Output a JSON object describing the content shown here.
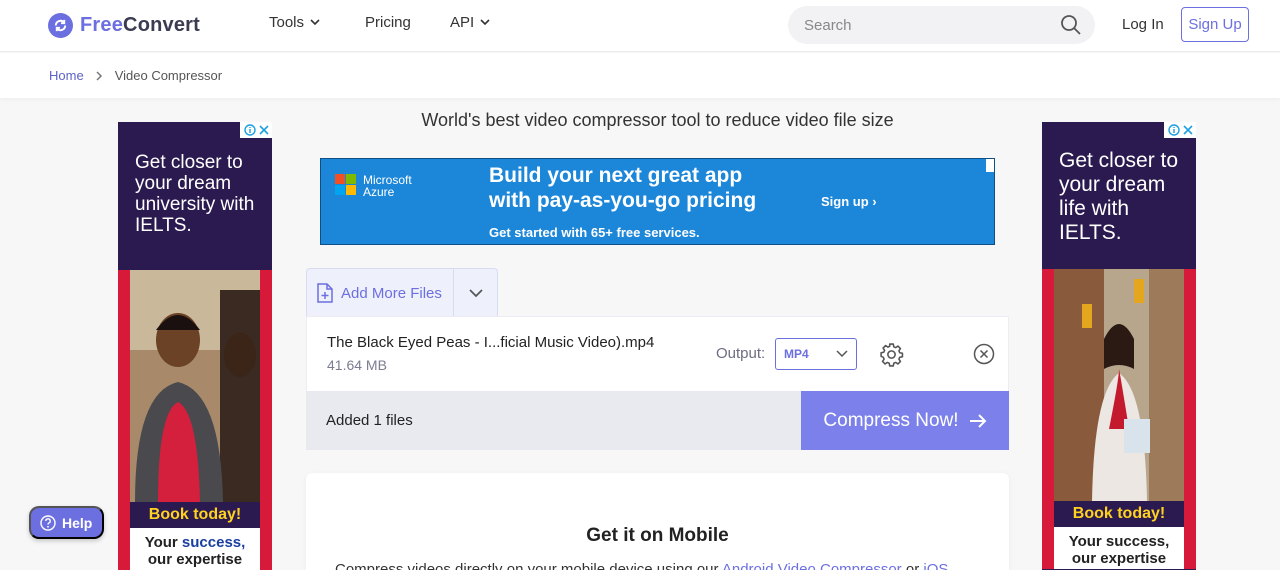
{
  "header": {
    "brand_free": "Free",
    "brand_convert": "Convert",
    "nav": [
      {
        "label": "Tools",
        "has_dropdown": true
      },
      {
        "label": "Pricing",
        "has_dropdown": false
      },
      {
        "label": "API",
        "has_dropdown": true
      }
    ],
    "search_placeholder": "Search",
    "login_label": "Log In",
    "signup_label": "Sign Up",
    "colors": {
      "accent": "#6c6fe0",
      "text": "#333333"
    }
  },
  "breadcrumb": {
    "home": "Home",
    "current": "Video Compressor"
  },
  "subtitle": "World's best video compressor tool to reduce video file size",
  "ads": {
    "left": {
      "headline": "Get closer to your dream university with IELTS.",
      "book": "Book today!",
      "tagline_1": "Your",
      "tagline_2": "success,",
      "tagline_3": "our expertise"
    },
    "right": {
      "headline": "Get closer to your dream life with IELTS.",
      "book": "Book today!",
      "tagline_1": "Your",
      "tagline_2": "success,",
      "tagline_3": "our expertise"
    },
    "banner": {
      "brand_line1": "Microsoft",
      "brand_line2": "Azure",
      "headline_1": "Build your next great app",
      "headline_2": "with pay-as-you-go pricing",
      "cta": "Sign up ›",
      "footer": "Get started with 65+ free services."
    }
  },
  "uploader": {
    "add_more_label": "Add More Files",
    "file": {
      "name": "The Black Eyed Peas - I...ficial Music Video).mp4",
      "size": "41.64 MB",
      "output_label": "Output:",
      "output_value": "MP4"
    },
    "added_text": "Added 1 files",
    "compress_label": "Compress Now!"
  },
  "mobile": {
    "title": "Get it on Mobile",
    "desc_prefix": "Compress videos directly on your mobile device using our ",
    "android_link": "Android Video Compressor",
    "desc_mid": " or ",
    "ios_link": "iOS"
  },
  "help_label": "Help"
}
